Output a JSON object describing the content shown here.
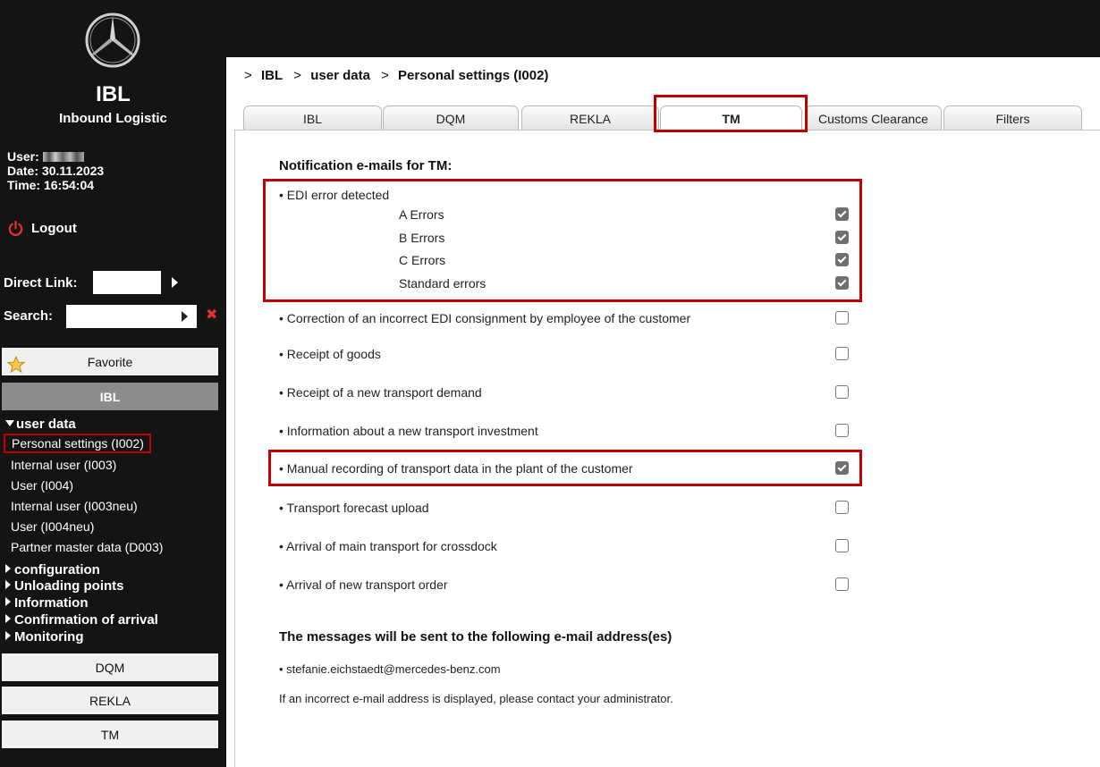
{
  "app": {
    "title": "IBL",
    "subtitle": "Inbound Logistic",
    "logo_icon": "mercedes-star-logo"
  },
  "session": {
    "user_label": "User:",
    "date_label": "Date:",
    "date": "30.11.2023",
    "time_label": "Time:",
    "time": "16:54:04"
  },
  "logout": {
    "label": "Logout",
    "icon": "power-icon",
    "color": "#e03030"
  },
  "direct_link": {
    "label": "Direct Link:",
    "value": ""
  },
  "search": {
    "label": "Search:",
    "value": ""
  },
  "favorite": {
    "label": "Favorite",
    "icon": "star-icon"
  },
  "sidebar": {
    "section_ibl": "IBL",
    "user_data_label": "user data",
    "user_data_items": [
      {
        "label": "Personal settings  (I002)",
        "active": true
      },
      {
        "label": "Internal user  (I003)"
      },
      {
        "label": "User  (I004)"
      },
      {
        "label": "Internal user  (I003neu)"
      },
      {
        "label": "User  (I004neu)"
      },
      {
        "label": "Partner master data  (D003)"
      }
    ],
    "collapsed_groups": [
      "configuration",
      "Unloading points",
      "Information",
      "Confirmation of arrival",
      "Monitoring"
    ],
    "bottom_buttons": [
      "DQM",
      "REKLA",
      "TM"
    ]
  },
  "breadcrumb": {
    "prefix": ">",
    "items": [
      "IBL",
      "user data",
      "Personal settings  (I002)"
    ]
  },
  "tabs": [
    {
      "label": "IBL"
    },
    {
      "label": "DQM"
    },
    {
      "label": "REKLA"
    },
    {
      "label": "TM",
      "active": true
    },
    {
      "label": "Customs Clearance"
    },
    {
      "label": "Filters"
    }
  ],
  "notifications": {
    "title": "Notification e-mails for TM:",
    "edi": {
      "label": "• EDI error detected",
      "sub": [
        {
          "label": "A Errors",
          "checked": true
        },
        {
          "label": "B Errors",
          "checked": true
        },
        {
          "label": "C Errors",
          "checked": true
        },
        {
          "label": "Standard errors",
          "checked": true
        }
      ]
    },
    "options": [
      {
        "label": "•  Correction of an incorrect EDI consignment by employee of the customer",
        "checked": false
      },
      {
        "label": "•  Receipt of goods",
        "checked": false
      },
      {
        "label": "•  Receipt of a new transport demand",
        "checked": false
      },
      {
        "label": "•  Information about a new transport investment",
        "checked": false
      },
      {
        "label": "•  Manual recording of transport data in the plant of the customer",
        "checked": true
      },
      {
        "label": "•  Transport forecast upload",
        "checked": false
      },
      {
        "label": "•  Arrival of main transport for crossdock",
        "checked": false
      },
      {
        "label": "•  Arrival of new transport order",
        "checked": false
      }
    ]
  },
  "recipients": {
    "title": "The messages will be sent to the following e-mail address(es)",
    "email": "• stefanie.eichstaedt@mercedes-benz.com",
    "hint": "If an incorrect e-mail address is displayed, please contact your administrator."
  },
  "colors": {
    "sidebar_bg": "#141414",
    "highlight": "#c00000",
    "section_bg": "#8c8c8c",
    "checkbox_checked": "#6f6f6f"
  }
}
